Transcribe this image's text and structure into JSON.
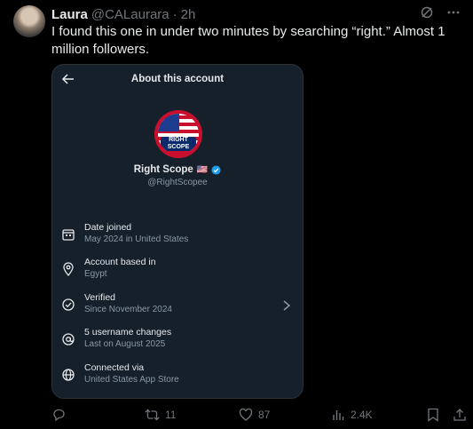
{
  "tweet": {
    "author_name": "Laura",
    "author_handle": "@CALaurara",
    "separator": "·",
    "time": "2h",
    "text": "I found this one in under two minutes by searching “right.” Almost 1 million followers."
  },
  "card": {
    "title": "About this account",
    "account_name": "Right Scope",
    "flag": "🇺🇸",
    "account_handle": "@RightScopee",
    "logo_text_1": "RIGHT",
    "logo_text_2": "SCOPE",
    "rows": [
      {
        "label": "Date joined",
        "sub": "May 2024 in United States",
        "icon": "calendar-icon"
      },
      {
        "label": "Account based in",
        "sub": "Egypt",
        "icon": "location-icon"
      },
      {
        "label": "Verified",
        "sub": "Since November 2024",
        "icon": "verified-check-icon"
      },
      {
        "label": "5 username changes",
        "sub": "Last on August 2025",
        "icon": "at-icon"
      },
      {
        "label": "Connected via",
        "sub": "United States App Store",
        "icon": "globe-icon"
      }
    ]
  },
  "actions": {
    "reposts": "11",
    "likes": "87",
    "views": "2.4K"
  },
  "colors": {
    "background": "#000000",
    "card_bg": "#15202b",
    "verified_blue": "#1d9bf0",
    "muted_text": "#71767b"
  }
}
